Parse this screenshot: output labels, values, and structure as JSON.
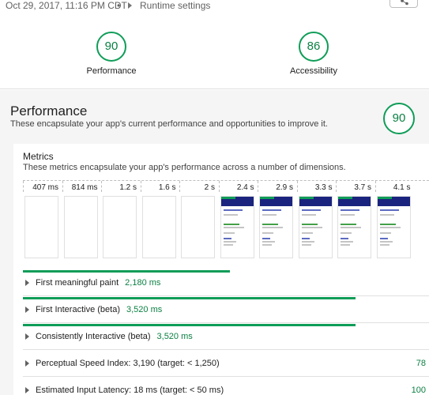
{
  "header": {
    "timestamp": "Oct 29, 2017, 11:16 PM CDT",
    "separator": "•",
    "runtime_settings": "Runtime settings",
    "share_icon": "share-icon"
  },
  "scores": [
    {
      "value": "90",
      "label": "Performance"
    },
    {
      "value": "86",
      "label": "Accessibility"
    }
  ],
  "performance": {
    "title": "Performance",
    "description": "These encapsulate your app's current performance and opportunities to improve it.",
    "score": "90"
  },
  "metrics": {
    "title": "Metrics",
    "description": "These metrics encapsulate your app's performance across a number of dimensions.",
    "filmstrip": [
      {
        "time": "407 ms",
        "rendered": false
      },
      {
        "time": "814 ms",
        "rendered": false
      },
      {
        "time": "1.2 s",
        "rendered": false
      },
      {
        "time": "1.6 s",
        "rendered": false
      },
      {
        "time": "2 s",
        "rendered": false
      },
      {
        "time": "2.4 s",
        "rendered": true
      },
      {
        "time": "2.9 s",
        "rendered": true
      },
      {
        "time": "3.3 s",
        "rendered": true
      },
      {
        "time": "3.7 s",
        "rendered": true
      },
      {
        "time": "4.1 s",
        "rendered": true
      }
    ],
    "rows": [
      {
        "name": "First meaningful paint",
        "value": "2,180 ms",
        "bar_fraction": 0.51,
        "score": ""
      },
      {
        "name": "First Interactive (beta)",
        "value": "3,520 ms",
        "bar_fraction": 0.82,
        "score": ""
      },
      {
        "name": "Consistently Interactive (beta)",
        "value": "3,520 ms",
        "bar_fraction": 0.82,
        "score": ""
      },
      {
        "name": "Perceptual Speed Index: 3,190 (target: < 1,250)",
        "value": "",
        "bar_fraction": 0,
        "score": "78"
      },
      {
        "name": "Estimated Input Latency: 18 ms (target: < 50 ms)",
        "value": "",
        "bar_fraction": 0,
        "score": "100"
      }
    ]
  },
  "colors": {
    "pass_green": "#0f9d58",
    "pass_text": "#0b8043",
    "section_bg": "#f5f5f5"
  }
}
